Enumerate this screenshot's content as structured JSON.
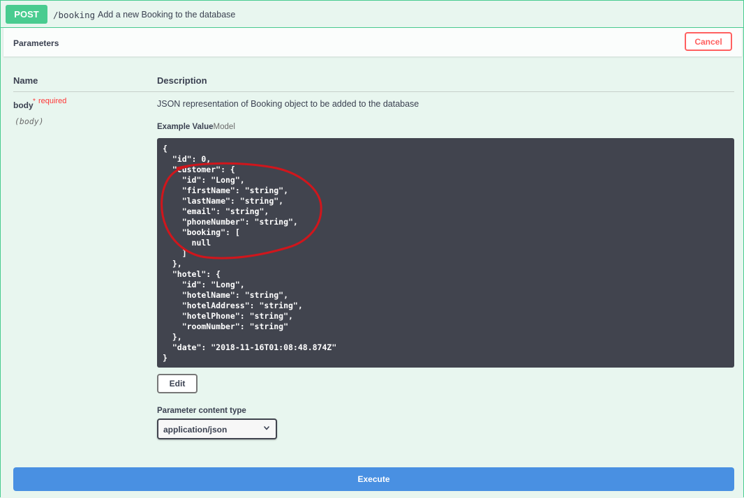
{
  "operation": {
    "method": "POST",
    "path": "/booking",
    "summary": "Add a new Booking to the database"
  },
  "parameters": {
    "title": "Parameters",
    "cancel_label": "Cancel",
    "col_name": "Name",
    "col_description": "Description"
  },
  "param": {
    "name": "body",
    "required_star": "*",
    "required_label": "required",
    "in": "(body)",
    "description": "JSON representation of Booking object to be added to the database",
    "tab_example": "Example Value",
    "tab_model": "Model",
    "example_code": "{\n  \"id\": 0,\n  \"customer\": {\n    \"id\": \"Long\",\n    \"firstName\": \"string\",\n    \"lastName\": \"string\",\n    \"email\": \"string\",\n    \"phoneNumber\": \"string\",\n    \"booking\": [\n      null\n    ]\n  },\n  \"hotel\": {\n    \"id\": \"Long\",\n    \"hotelName\": \"string\",\n    \"hotelAddress\": \"string\",\n    \"hotelPhone\": \"string\",\n    \"roomNumber\": \"string\"\n  },\n  \"date\": \"2018-11-16T01:08:48.874Z\"\n}",
    "edit_label": "Edit",
    "content_type_label": "Parameter content type",
    "content_type_value": "application/json"
  },
  "execute_label": "Execute",
  "colors": {
    "post_green": "#49cc90",
    "cancel_red": "#ff6060",
    "execute_blue": "#4990e2",
    "code_bg": "#41444e",
    "annotation_red": "#d0161c"
  },
  "icons": {
    "select_chevron": "chevron-down-icon",
    "annotation": "freehand-circle-annotation"
  }
}
